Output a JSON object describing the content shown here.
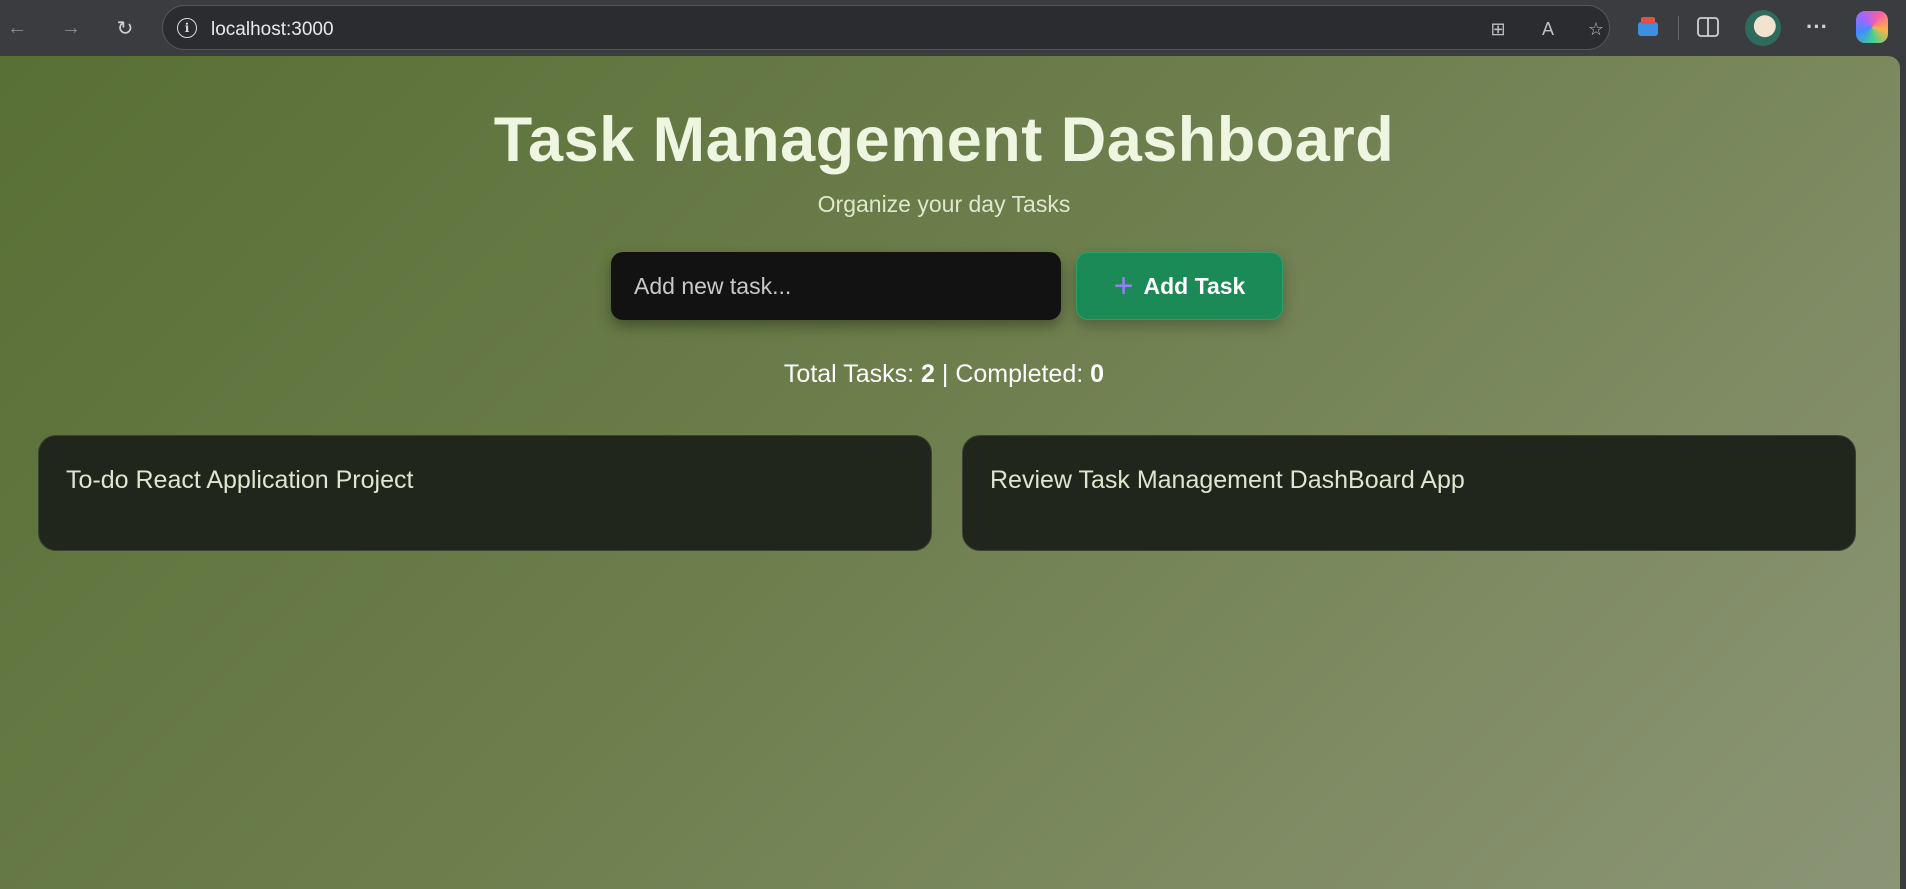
{
  "browser": {
    "url": "localhost:3000",
    "icons": [
      "back-icon",
      "forward-icon",
      "reload-icon",
      "site-info-icon",
      "apps-icon",
      "read-aloud-icon",
      "favorite-icon",
      "extension-icon",
      "split-screen-icon",
      "profile-avatar",
      "more-icon",
      "copilot-icon"
    ],
    "read_aloud_label": "A",
    "more_label": "···"
  },
  "app": {
    "title": "Task Management Dashboard",
    "subtitle": "Organize your day Tasks",
    "input_placeholder": "Add new task...",
    "add_button_label": "Add Task",
    "stats": {
      "total_label": "Total Tasks:",
      "total_value": "2",
      "separator": "|",
      "completed_label": "Completed:",
      "completed_value": "0"
    },
    "tasks": [
      {
        "text": "To-do React Application Project"
      },
      {
        "text": "Review Task Management DashBoard App"
      }
    ],
    "colors": {
      "background_start": "#586f35",
      "background_end": "#8b9576",
      "add_button": "#1c8a56",
      "card": "#21261d",
      "input": "#121212"
    }
  }
}
